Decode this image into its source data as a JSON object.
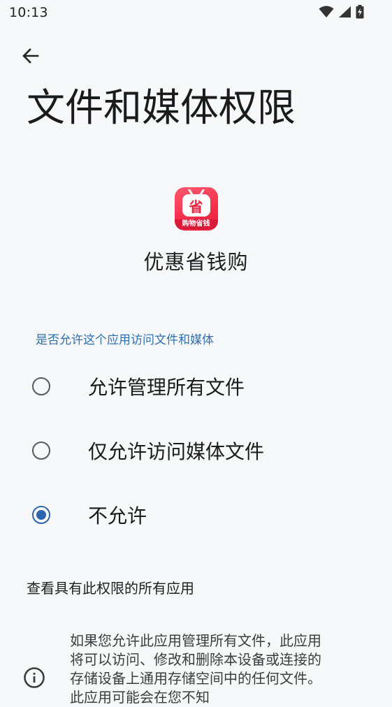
{
  "status_bar": {
    "time": "10:13",
    "icons": [
      "wifi-icon",
      "signal-icon",
      "battery-charging-icon"
    ]
  },
  "nav": {
    "back_icon": "arrow-left-icon"
  },
  "page": {
    "title": "文件和媒体权限"
  },
  "app": {
    "icon_glyph": "省",
    "icon_caption": "购物省钱",
    "name": "优惠省钱购",
    "brand_color": "#f42d4a"
  },
  "permission": {
    "section_label": "是否允许这个应用访问文件和媒体",
    "options": [
      {
        "label": "允许管理所有文件",
        "selected": false
      },
      {
        "label": "仅允许访问媒体文件",
        "selected": false
      },
      {
        "label": "不允许",
        "selected": true
      }
    ],
    "accent_color": "#2e66ad"
  },
  "footer": {
    "all_apps_link": "查看具有此权限的所有应用",
    "info_icon": "info-icon",
    "info_text": "如果您允许此应用管理所有文件，此应用将可以访问、修改和删除本设备或连接的存储设备上通用存储空间中的任何文件。此应用可能会在您不知"
  }
}
